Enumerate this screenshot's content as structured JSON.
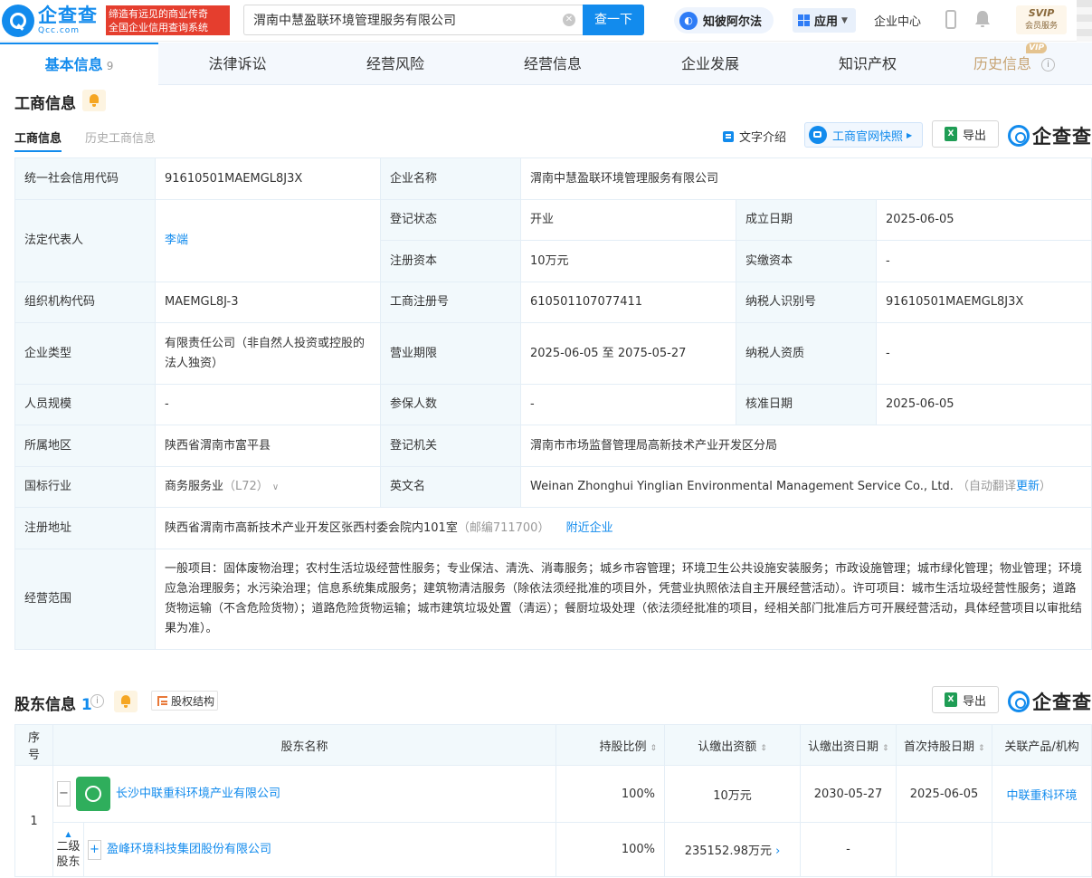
{
  "header": {
    "logo_cn": "企查查",
    "logo_en": "Qcc.com",
    "slogan_line1": "缔造有远见的商业传奇",
    "slogan_line2": "全国企业信用查询系统",
    "search_value": "渭南中慧盈联环境管理服务有限公司",
    "search_button": "查一下",
    "ai_label": "知彼阿尔法",
    "app_label": "应用",
    "enterprise_center": "企业中心",
    "svip_top": "SVIP",
    "svip_bottom": "会员服务"
  },
  "tabs": [
    {
      "label": "基本信息",
      "count": "9"
    },
    {
      "label": "法律诉讼"
    },
    {
      "label": "经营风险"
    },
    {
      "label": "经营信息"
    },
    {
      "label": "企业发展"
    },
    {
      "label": "知识产权"
    },
    {
      "label": "历史信息",
      "badge": "VIP"
    }
  ],
  "business_info": {
    "title": "工商信息",
    "subtab_active": "工商信息",
    "subtab_inactive": "历史工商信息",
    "text_intro": "文字介绍",
    "snapshot": "工商官网快照",
    "export": "导出",
    "brand": "企查查",
    "rows": {
      "credit_code_label": "统一社会信用代码",
      "credit_code": "91610501MAEMGL8J3X",
      "company_name_label": "企业名称",
      "company_name": "渭南中慧盈联环境管理服务有限公司",
      "legal_rep_label": "法定代表人",
      "legal_rep": "李端",
      "reg_status_label": "登记状态",
      "reg_status": "开业",
      "est_date_label": "成立日期",
      "est_date": "2025-06-05",
      "reg_capital_label": "注册资本",
      "reg_capital": "10万元",
      "paid_capital_label": "实缴资本",
      "paid_capital": "-",
      "org_code_label": "组织机构代码",
      "org_code": "MAEMGL8J-3",
      "biz_reg_no_label": "工商注册号",
      "biz_reg_no": "610501107077411",
      "taxpayer_id_label": "纳税人识别号",
      "taxpayer_id": "91610501MAEMGL8J3X",
      "company_type_label": "企业类型",
      "company_type": "有限责任公司（非自然人投资或控股的法人独资）",
      "term_label": "营业期限",
      "term": "2025-06-05 至 2075-05-27",
      "taxpayer_qual_label": "纳税人资质",
      "taxpayer_qual": "-",
      "staff_size_label": "人员规模",
      "staff_size": "-",
      "insured_label": "参保人数",
      "insured": "-",
      "approval_date_label": "核准日期",
      "approval_date": "2025-06-05",
      "region_label": "所属地区",
      "region": "陕西省渭南市富平县",
      "reg_authority_label": "登记机关",
      "reg_authority": "渭南市市场监督管理局高新技术产业开发区分局",
      "industry_label": "国标行业",
      "industry": "商务服务业",
      "industry_code": "（L72）",
      "english_name_label": "英文名",
      "english_name": "Weinan Zhonghui Yinglian Environmental Management Service Co., Ltd.",
      "auto_translate": "（自动翻译",
      "update": "更新",
      "close_paren": "）",
      "address_label": "注册地址",
      "address": "陕西省渭南市高新技术产业开发区张西村委会院内101室",
      "postcode": "（邮编711700）",
      "nearby": "附近企业",
      "scope_label": "经营范围",
      "scope": "一般项目：固体废物治理；农村生活垃圾经营性服务；专业保洁、清洗、消毒服务；城乡市容管理；环境卫生公共设施安装服务；市政设施管理；城市绿化管理；物业管理；环境应急治理服务；水污染治理；信息系统集成服务；建筑物清洁服务（除依法须经批准的项目外，凭营业执照依法自主开展经营活动）。许可项目：城市生活垃圾经营性服务；道路货物运输（不含危险货物）；道路危险货物运输；城市建筑垃圾处置（清运）；餐厨垃圾处理（依法须经批准的项目，经相关部门批准后方可开展经营活动，具体经营项目以审批结果为准）。"
    }
  },
  "shareholders": {
    "title": "股东信息",
    "count": "1",
    "structure_btn": "股权结构",
    "export": "导出",
    "brand": "企查查",
    "columns": [
      "序号",
      "股东名称",
      "持股比例",
      "认缴出资额",
      "认缴出资日期",
      "首次持股日期",
      "关联产品/机构"
    ],
    "rows": [
      {
        "index": "1",
        "name": "长沙中联重科环境产业有限公司",
        "ratio": "100%",
        "subscribed": "10万元",
        "sub_date": "2030-05-27",
        "first_date": "2025-06-05",
        "product": "中联重科环境"
      }
    ],
    "second_level": {
      "label_line1": "二级",
      "label_line2": "股东",
      "name": "盈峰环境科技集团股份有限公司",
      "ratio": "100%",
      "subscribed": "235152.98万元",
      "sub_date": "-"
    }
  }
}
